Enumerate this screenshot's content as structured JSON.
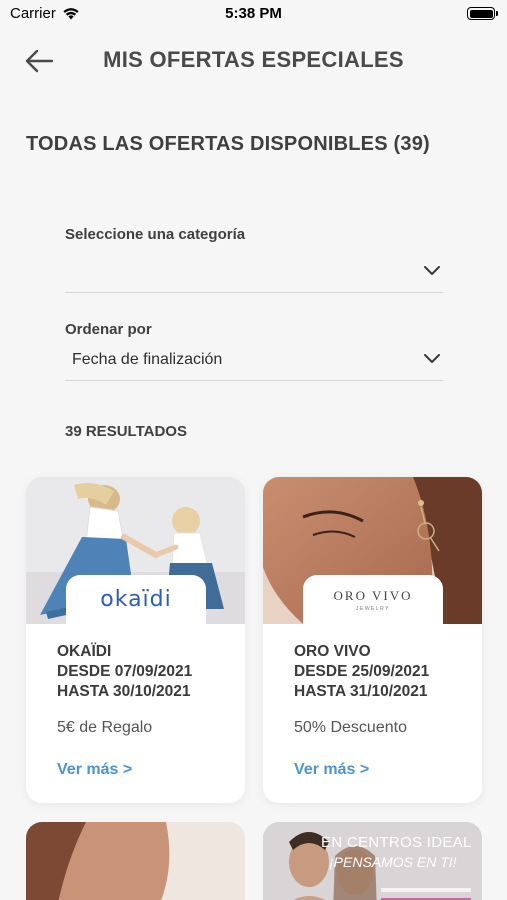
{
  "status_bar": {
    "carrier": "Carrier",
    "time": "5:38 PM"
  },
  "header": {
    "title": "MIS OFERTAS ESPECIALES",
    "back_icon": "arrow-left-icon"
  },
  "section_title": "TODAS LAS OFERTAS DISPONIBLES (39)",
  "filters": {
    "category": {
      "label": "Seleccione una categoría",
      "value": ""
    },
    "sort": {
      "label": "Ordenar por",
      "value": "Fecha de finalización"
    }
  },
  "results_label": "39 RESULTADOS",
  "offers": [
    {
      "brand_logo": "okaïdi",
      "line1": "OKAÏDI",
      "line2": "DESDE 07/09/2021",
      "line3": "HASTA 30/10/2021",
      "offer": "5€ de Regalo",
      "link": "Ver más >"
    },
    {
      "brand_logo": "ORO VIVO",
      "brand_logo_sub": "JEWELRY",
      "line1": "ORO VIVO",
      "line2": "DESDE 25/09/2021",
      "line3": "HASTA 31/10/2021",
      "offer": "50% Descuento",
      "link": "Ver más >"
    }
  ],
  "partial_cards": [
    {
      "banner_line1": "",
      "banner_line2": ""
    },
    {
      "banner_line1": "EN CENTROS IDEAL",
      "banner_line2": "¡PENSAMOS EN TI!"
    }
  ],
  "colors": {
    "link": "#4a94d0",
    "okaidi_logo": "#2f5bb8",
    "background": "#f6f6f6"
  }
}
